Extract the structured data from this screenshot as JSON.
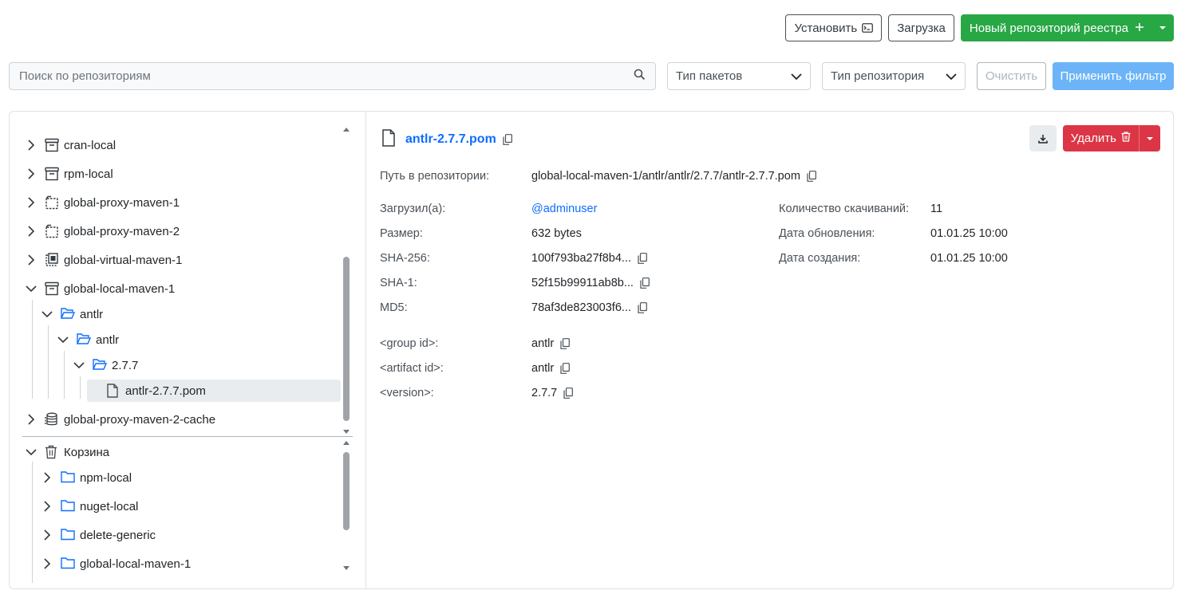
{
  "toolbar": {
    "install_label": "Установить",
    "upload_label": "Загрузка",
    "new_repo_label": "Новый репозиторий реестра"
  },
  "filters": {
    "search_placeholder": "Поиск по репозиториям",
    "package_type": "Тип пакетов",
    "repo_type": "Тип репозитория",
    "clear_label": "Очистить",
    "apply_label": "Применить фильтр"
  },
  "tree": {
    "repos": [
      {
        "label": "cran-local",
        "icon": "archive-icon"
      },
      {
        "label": "rpm-local",
        "icon": "archive-icon"
      },
      {
        "label": "global-proxy-maven-1",
        "icon": "proxy-icon"
      },
      {
        "label": "global-proxy-maven-2",
        "icon": "proxy-icon"
      },
      {
        "label": "global-virtual-maven-1",
        "icon": "virtual-icon"
      },
      {
        "label": "global-local-maven-1",
        "icon": "archive-icon"
      },
      {
        "label": "antlr",
        "icon": "folder-open-icon"
      },
      {
        "label": "antlr",
        "icon": "folder-open-icon"
      },
      {
        "label": "2.7.7",
        "icon": "folder-open-icon"
      },
      {
        "label": "antlr-2.7.7.pom",
        "icon": "file-icon"
      },
      {
        "label": "global-proxy-maven-2-cache",
        "icon": "database-icon"
      }
    ],
    "trash": {
      "label": "Корзина",
      "items": [
        {
          "label": "npm-local"
        },
        {
          "label": "nuget-local"
        },
        {
          "label": "delete-generic"
        },
        {
          "label": "global-local-maven-1"
        }
      ]
    }
  },
  "detail": {
    "file_name": "antlr-2.7.7.pom",
    "delete_label": "Удалить",
    "path_label": "Путь в репозитории:",
    "path_value": "global-local-maven-1/antlr/antlr/2.7.7/antlr-2.7.7.pom",
    "uploaded_by_label": "Загрузил(а):",
    "uploaded_by_value": "@adminuser",
    "size_label": "Размер:",
    "size_value": "632 bytes",
    "sha256_label": "SHA-256:",
    "sha256_value": "100f793ba27f8b4...",
    "sha1_label": "SHA-1:",
    "sha1_value": "52f15b99911ab8b...",
    "md5_label": "MD5:",
    "md5_value": "78af3de823003f6...",
    "downloads_label": "Количество скачиваний:",
    "downloads_value": "11",
    "updated_label": "Дата обновления:",
    "updated_value": "01.01.25 10:00",
    "created_label": "Дата создания:",
    "created_value": "01.01.25 10:00",
    "group_id_label": "<group id>:",
    "group_id_value": "antlr",
    "artifact_id_label": "<artifact id>:",
    "artifact_id_value": "antlr",
    "version_label": "<version>:",
    "version_value": "2.7.7"
  },
  "colors": {
    "primary": "#0d6efd",
    "success": "#28a745",
    "danger": "#dc3545",
    "apply": "#6cb4f7"
  }
}
